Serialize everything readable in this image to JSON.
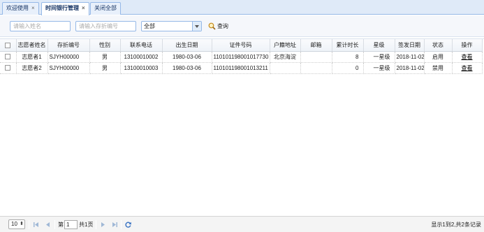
{
  "tabs": [
    {
      "label": "欢迎使用",
      "close": "×"
    },
    {
      "label": "时间银行管理",
      "close": "×"
    },
    {
      "label": "关闭全部"
    }
  ],
  "toolbar": {
    "name_placeholder": "请输入姓名",
    "passbook_placeholder": "请输入存折编号",
    "status_value": "全部",
    "search_label": "查询"
  },
  "grid": {
    "columns": [
      "志愿者姓名",
      "存折编号",
      "性别",
      "联系电话",
      "出生日期",
      "证件号码",
      "户籍地址",
      "邮箱",
      "累计时长",
      "星级",
      "签发日期",
      "状态",
      "操作"
    ],
    "rows": [
      [
        "志愿者1",
        "SJYH00000",
        "男",
        "13100010002",
        "1980-03-06",
        "110101198001017730",
        "北京海淀",
        "",
        "8",
        "一星级",
        "2018-11-02",
        "启用",
        "查看"
      ],
      [
        "志愿者2",
        "SJYH00000",
        "男",
        "13100010003",
        "1980-03-06",
        "110101198001013211",
        "",
        "",
        "0",
        "一星级",
        "2018-11-02",
        "禁用",
        "查看"
      ]
    ]
  },
  "pager": {
    "page_size": "10",
    "page_prefix": "第",
    "page_number": "1",
    "page_suffix": "共1页",
    "summary": "显示1到2,共2条记录"
  },
  "colors": {
    "tab_border": "#95b8e7",
    "tab_bg": "#dfeaf8",
    "toolbar_bg": "#f5f7fb"
  }
}
